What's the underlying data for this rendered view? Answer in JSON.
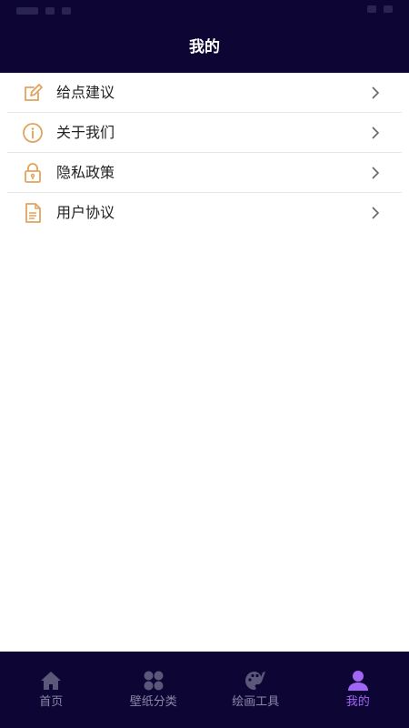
{
  "header": {
    "title": "我的"
  },
  "menu": {
    "items": [
      {
        "label": "给点建议",
        "icon": "edit-icon"
      },
      {
        "label": "关于我们",
        "icon": "info-icon"
      },
      {
        "label": "隐私政策",
        "icon": "lock-icon"
      },
      {
        "label": "用户协议",
        "icon": "document-icon"
      }
    ]
  },
  "tabbar": {
    "tabs": [
      {
        "label": "首页",
        "icon": "home-icon",
        "active": false
      },
      {
        "label": "壁纸分类",
        "icon": "grid-icon",
        "active": false
      },
      {
        "label": "绘画工具",
        "icon": "palette-icon",
        "active": false
      },
      {
        "label": "我的",
        "icon": "user-icon",
        "active": true
      }
    ]
  },
  "colors": {
    "header_bg": "#0d0634",
    "icon_accent": "#e3a35e",
    "tab_active": "#a266f5",
    "tab_inactive": "#8a88a8"
  }
}
